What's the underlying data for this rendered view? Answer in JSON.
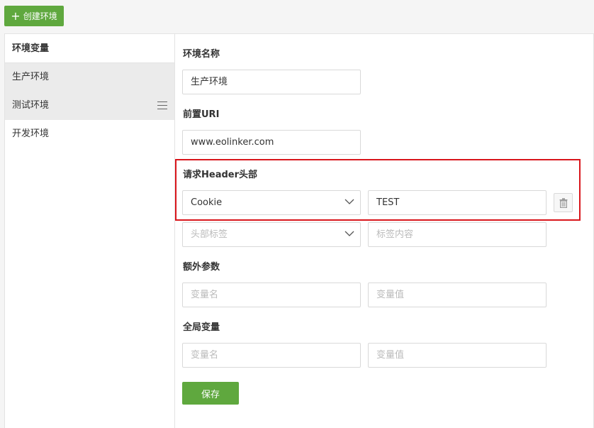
{
  "toolbar": {
    "create_label": "创建环境",
    "create_icon": "plus-icon",
    "accent": "#5fa83e"
  },
  "sidebar": {
    "title": "环境变量",
    "items": [
      {
        "label": "生产环境",
        "shaded": true
      },
      {
        "label": "测试环境",
        "shaded": true,
        "icon": "menu-icon"
      },
      {
        "label": "开发环境",
        "shaded": false
      }
    ]
  },
  "form": {
    "env_name": {
      "label": "环境名称",
      "value": "生产环境"
    },
    "uri": {
      "label": "前置URI",
      "value": "www.eolinker.com"
    },
    "headers": {
      "label": "请求Header头部",
      "highlight_color": "#d9161c",
      "rows": [
        {
          "key": "Cookie",
          "value": "TEST",
          "delete_icon": "trash-icon"
        }
      ],
      "new_row": {
        "key_placeholder": "头部标签",
        "value_placeholder": "标签内容"
      }
    },
    "extra_params": {
      "label": "额外参数",
      "name_placeholder": "变量名",
      "value_placeholder": "变量值"
    },
    "global_vars": {
      "label": "全局变量",
      "name_placeholder": "变量名",
      "value_placeholder": "变量值"
    },
    "save_label": "保存"
  }
}
